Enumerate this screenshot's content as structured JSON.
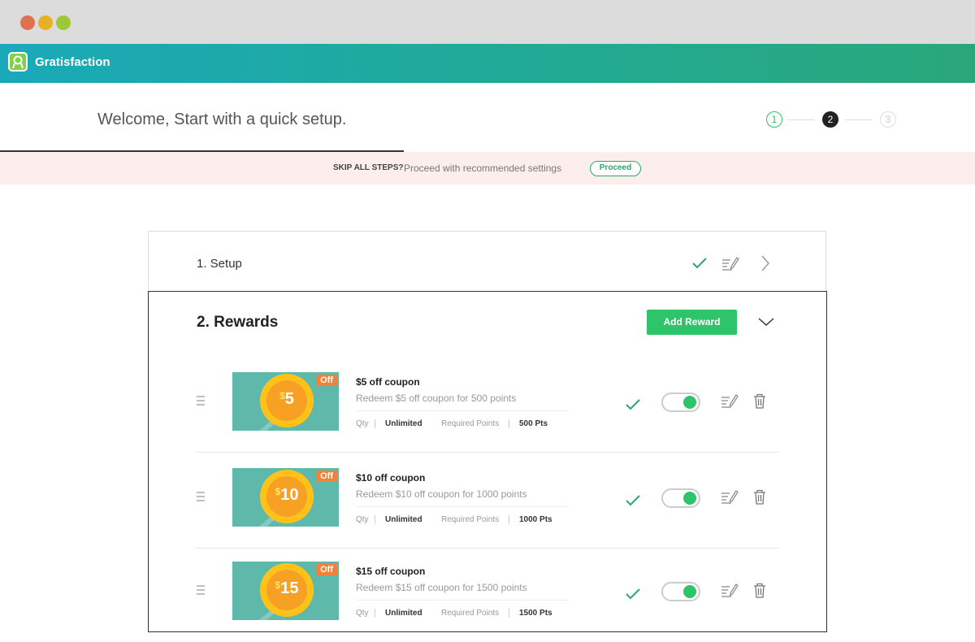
{
  "app": {
    "brand": "Gratisfaction"
  },
  "header": {
    "welcome": "Welcome, Start with a quick setup."
  },
  "steps": [
    {
      "label": "1",
      "state": "done"
    },
    {
      "label": "2",
      "state": "current"
    },
    {
      "label": "3",
      "state": "pending"
    }
  ],
  "skip_bar": {
    "label": "SKIP ALL STEPS?",
    "text": "Proceed with recommended settings",
    "button": "Proceed"
  },
  "setup_panel": {
    "title": "1. Setup"
  },
  "rewards_panel": {
    "title": "2. Rewards",
    "add_button": "Add Reward",
    "rewards": [
      {
        "amount": "5",
        "dollar": "$",
        "badge": "Off",
        "title": "$5 off coupon",
        "description": "Redeem $5 off coupon for 500 points",
        "qty_label": "Qty",
        "qty_value": "Unlimited",
        "points_label": "Required Points",
        "points_value": "500 Pts",
        "enabled": true
      },
      {
        "amount": "10",
        "dollar": "$",
        "badge": "Off",
        "title": "$10 off coupon",
        "description": "Redeem $10 off coupon for 1000 points",
        "qty_label": "Qty",
        "qty_value": "Unlimited",
        "points_label": "Required Points",
        "points_value": "1000 Pts",
        "enabled": true
      },
      {
        "amount": "15",
        "dollar": "$",
        "badge": "Off",
        "title": "$15 off coupon",
        "description": "Redeem $15 off coupon for 1500 points",
        "qty_label": "Qty",
        "qty_value": "Unlimited",
        "points_label": "Required Points",
        "points_value": "1500 Pts",
        "enabled": true
      }
    ]
  },
  "colors": {
    "accent": "#2dc46a",
    "coupon_bg": "#5eb9aa",
    "coin": "#ffc21a",
    "badge": "#f2813a"
  }
}
